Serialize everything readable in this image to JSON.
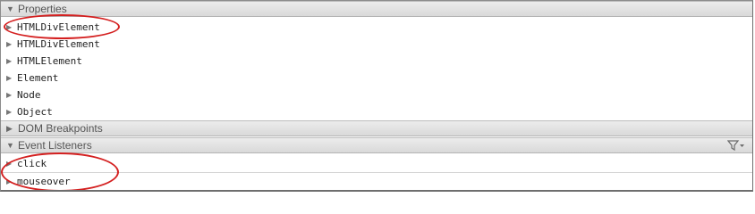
{
  "properties": {
    "header_label": "Properties",
    "items": [
      {
        "label": "HTMLDivElement"
      },
      {
        "label": "HTMLDivElement"
      },
      {
        "label": "HTMLElement"
      },
      {
        "label": "Element"
      },
      {
        "label": "Node"
      },
      {
        "label": "Object"
      }
    ]
  },
  "dom_breakpoints": {
    "header_label": "DOM Breakpoints"
  },
  "event_listeners": {
    "header_label": "Event Listeners",
    "filter_icon": "filter-icon",
    "items": [
      {
        "label": "click"
      },
      {
        "label": "mouseover"
      }
    ]
  },
  "colors": {
    "annotation_red": "#d42020"
  }
}
